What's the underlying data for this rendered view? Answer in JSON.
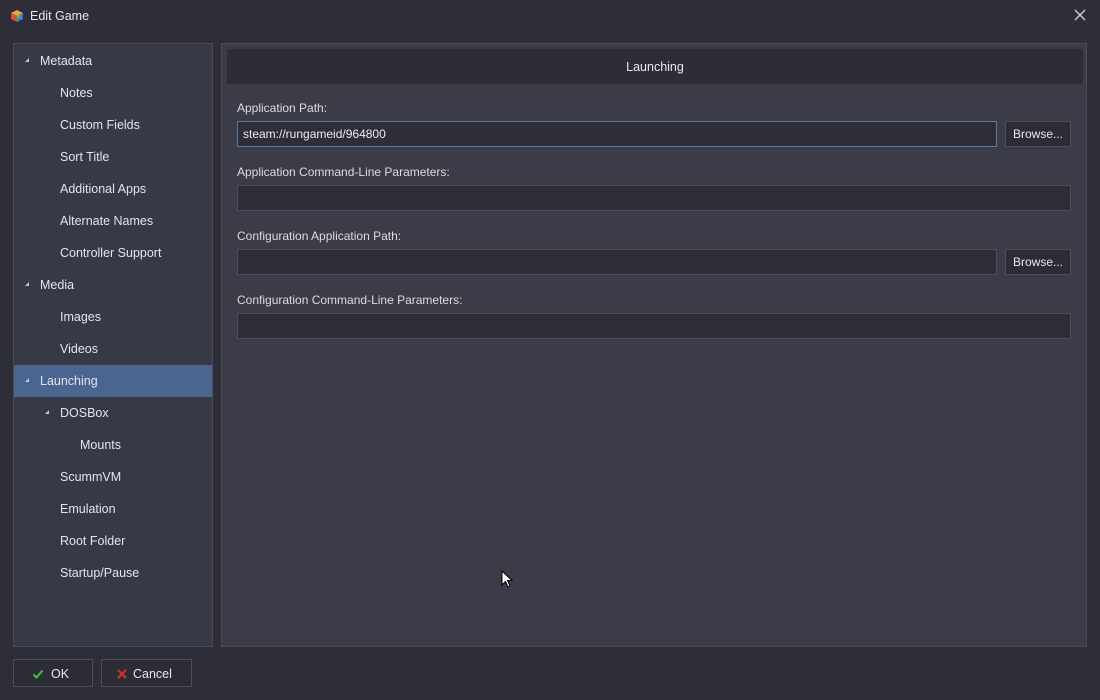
{
  "window": {
    "title": "Edit Game",
    "app_icon": "launchbox-cube-icon",
    "close_icon": "close-icon"
  },
  "sidebar": {
    "items": [
      {
        "label": "Metadata",
        "level": 0,
        "expandable": true,
        "selected": false
      },
      {
        "label": "Notes",
        "level": 1,
        "expandable": false,
        "selected": false
      },
      {
        "label": "Custom Fields",
        "level": 1,
        "expandable": false,
        "selected": false
      },
      {
        "label": "Sort Title",
        "level": 1,
        "expandable": false,
        "selected": false
      },
      {
        "label": "Additional Apps",
        "level": 1,
        "expandable": false,
        "selected": false
      },
      {
        "label": "Alternate Names",
        "level": 1,
        "expandable": false,
        "selected": false
      },
      {
        "label": "Controller Support",
        "level": 1,
        "expandable": false,
        "selected": false
      },
      {
        "label": "Media",
        "level": 0,
        "expandable": true,
        "selected": false
      },
      {
        "label": "Images",
        "level": 1,
        "expandable": false,
        "selected": false
      },
      {
        "label": "Videos",
        "level": 1,
        "expandable": false,
        "selected": false
      },
      {
        "label": "Launching",
        "level": 0,
        "expandable": true,
        "selected": true
      },
      {
        "label": "DOSBox",
        "level": 1,
        "expandable": true,
        "selected": false
      },
      {
        "label": "Mounts",
        "level": 2,
        "expandable": false,
        "selected": false
      },
      {
        "label": "ScummVM",
        "level": 1,
        "expandable": false,
        "selected": false
      },
      {
        "label": "Emulation",
        "level": 1,
        "expandable": false,
        "selected": false
      },
      {
        "label": "Root Folder",
        "level": 1,
        "expandable": false,
        "selected": false
      },
      {
        "label": "Startup/Pause",
        "level": 1,
        "expandable": false,
        "selected": false
      }
    ]
  },
  "main": {
    "header": "Launching",
    "fields": {
      "app_path": {
        "label": "Application Path:",
        "value": "steam://rungameid/964800",
        "browse": "Browse..."
      },
      "app_params": {
        "label": "Application Command-Line Parameters:",
        "value": ""
      },
      "config_path": {
        "label": "Configuration Application Path:",
        "value": "",
        "browse": "Browse..."
      },
      "config_params": {
        "label": "Configuration Command-Line Parameters:",
        "value": ""
      }
    }
  },
  "footer": {
    "ok_label": "OK",
    "cancel_label": "Cancel",
    "ok_icon": "checkmark-icon",
    "cancel_icon": "cross-icon"
  },
  "colors": {
    "background": "#2d2e38",
    "panel": "#3b3c48",
    "selected": "#4a6590",
    "ok_green": "#3cc43c",
    "cancel_red": "#d83030"
  }
}
